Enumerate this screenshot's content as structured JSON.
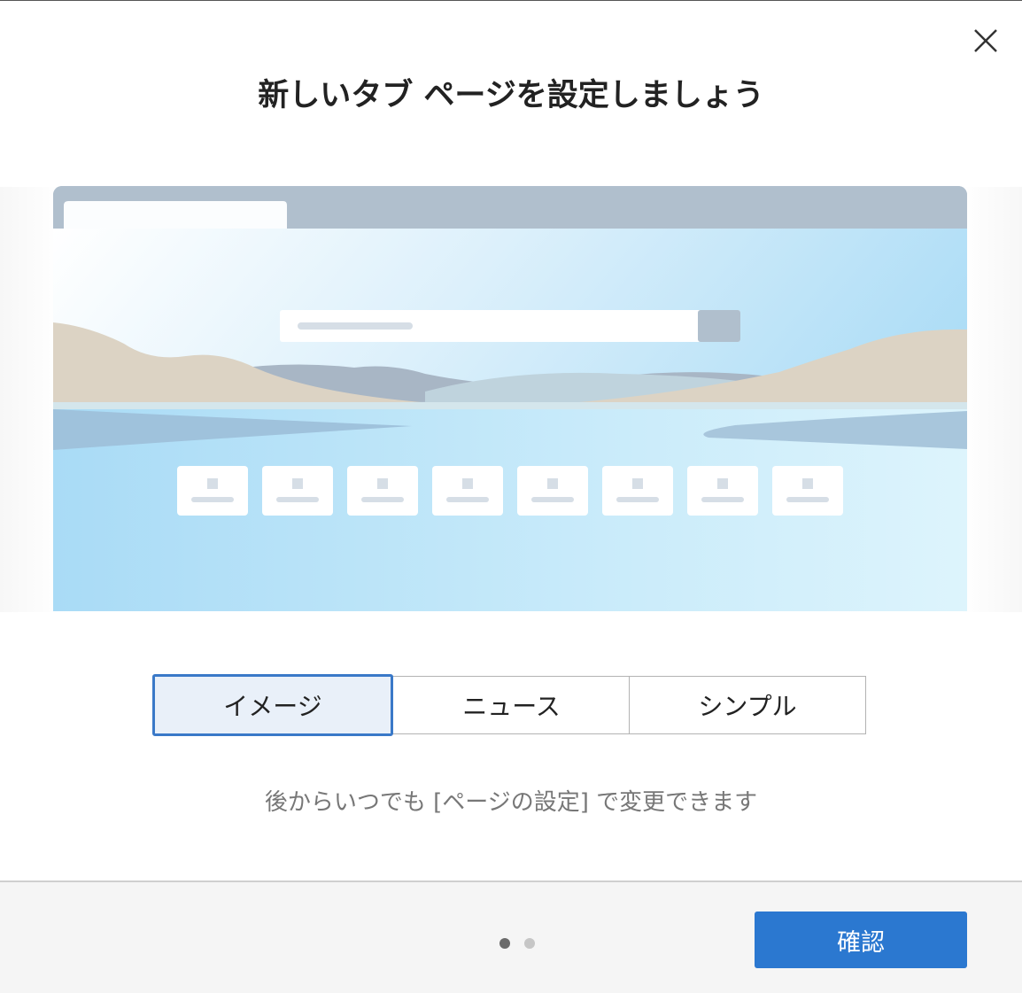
{
  "dialog": {
    "title": "新しいタブ ページを設定しましょう",
    "close_icon": "close-icon"
  },
  "layout_options": [
    {
      "label": "イメージ",
      "selected": true
    },
    {
      "label": "ニュース",
      "selected": false
    },
    {
      "label": "シンプル",
      "selected": false
    }
  ],
  "hint": "後からいつでも [ページの設定] で変更できます",
  "pagination": {
    "current": 1,
    "total": 2
  },
  "footer": {
    "confirm_label": "確認"
  },
  "colors": {
    "accent": "#2b78d0",
    "selected_bg": "#e9f0f9"
  }
}
